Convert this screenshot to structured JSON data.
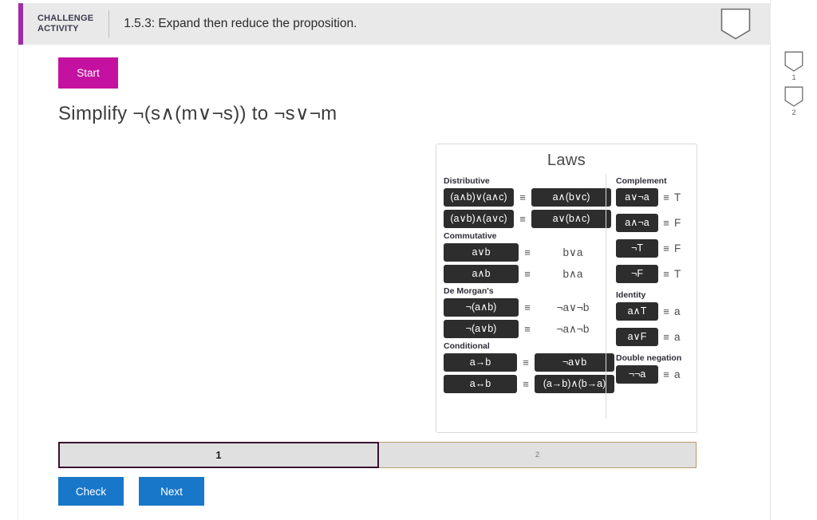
{
  "header": {
    "challenge_line1": "CHALLENGE",
    "challenge_line2": "ACTIVITY",
    "title": "1.5.3: Expand then reduce the proposition.",
    "accent_color": "#a32ba8",
    "pennant_icon": "pennant-icon"
  },
  "side_badges": [
    {
      "label": "1",
      "icon": "pennant-icon"
    },
    {
      "label": "2",
      "icon": "pennant-icon"
    }
  ],
  "start_button": {
    "label": "Start",
    "color": "#c4119f"
  },
  "problem": {
    "text": "Simplify ¬(s∧(m∨¬s)) to ¬s∨¬m"
  },
  "laws": {
    "title": "Laws",
    "equiv_symbol": "≡",
    "left_groups": [
      {
        "name": "Distributive",
        "rows": [
          {
            "left": "(a∧b)∨(a∧c)",
            "right": "a∧(b∨c)",
            "right_is_chip": true
          },
          {
            "left": "(a∨b)∧(a∨c)",
            "right": "a∨(b∧c)",
            "right_is_chip": true
          }
        ]
      },
      {
        "name": "Commutative",
        "rows": [
          {
            "left": "a∨b",
            "right": "b∨a",
            "right_is_chip": false
          },
          {
            "left": "a∧b",
            "right": "b∧a",
            "right_is_chip": false
          }
        ]
      },
      {
        "name": "De Morgan's",
        "rows": [
          {
            "left": "¬(a∧b)",
            "right": "¬a∨¬b",
            "right_is_chip": false
          },
          {
            "left": "¬(a∨b)",
            "right": "¬a∧¬b",
            "right_is_chip": false
          }
        ]
      },
      {
        "name": "Conditional",
        "rows": [
          {
            "left": "a→b",
            "right": "¬a∨b",
            "right_is_chip": true
          },
          {
            "left": "a↔b",
            "right": "(a→b)∧(b→a)",
            "right_is_chip": true
          }
        ]
      }
    ],
    "right_groups": [
      {
        "name": "Complement",
        "rows": [
          {
            "left": "a∨¬a",
            "right": "T"
          },
          {
            "left": "a∧¬a",
            "right": "F"
          },
          {
            "left": "¬T",
            "right": "F"
          },
          {
            "left": "¬F",
            "right": "T"
          }
        ]
      },
      {
        "name": "Identity",
        "rows": [
          {
            "left": "a∧T",
            "right": "a"
          },
          {
            "left": "a∨F",
            "right": "a"
          }
        ]
      },
      {
        "name": "Double negation",
        "rows": [
          {
            "left": "¬¬a",
            "right": "a"
          }
        ]
      }
    ]
  },
  "steps": {
    "tabs": [
      {
        "label": "1",
        "active": true
      },
      {
        "label": "2",
        "active": false
      }
    ]
  },
  "bottom_buttons": {
    "check_label": "Check",
    "next_label": "Next",
    "color": "#1877c9"
  }
}
